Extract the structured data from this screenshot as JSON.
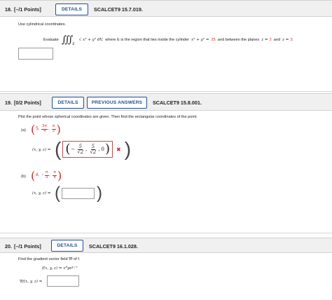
{
  "q18": {
    "number": "18.",
    "points": "[–/1 Points]",
    "details_label": "DETAILS",
    "code": "SCALCET9 15.7.019.",
    "instruction": "Use cylindrical coordinates.",
    "evaluate_word": "Evaluate",
    "region_subscript": "E",
    "integrand": "√ x² + y² dV,",
    "where_text": "where E is the region that lies inside the cylinder",
    "cyl_eq": "x² + y² =",
    "cyl_value": "25",
    "between_text": "and between the planes",
    "plane1": "z =",
    "plane1_value": "2",
    "and_text": "and",
    "plane2": "z =",
    "plane2_value": "3."
  },
  "q19": {
    "number": "19.",
    "points": "[0/2 Points]",
    "details_label": "DETAILS",
    "previous_label": "PREVIOUS ANSWERS",
    "code": "SCALCET9 15.8.001.",
    "instruction": "Plot the point whose spherical coordinates are given. Then find the rectangular coordinates of the point.",
    "part_a": {
      "label": "(a)",
      "first": "5,",
      "second_num": "3π",
      "second_den": "4",
      "third_num": "π",
      "third_den": "2",
      "xyz_label": "(x, y, z) =",
      "ans_x_num": "5",
      "ans_x_den": "√2",
      "ans_y_num": "5",
      "ans_y_den": "√2",
      "ans_z": "0",
      "result_mark": "✖"
    },
    "part_b": {
      "label": "(b)",
      "first": "8,",
      "second_num": "π",
      "second_den": "3",
      "third_num": "π",
      "third_den": "4",
      "xyz_label": "(x, y, z) ="
    }
  },
  "q20": {
    "number": "20.",
    "points": "[–/1 Points]",
    "details_label": "DETAILS",
    "code": "SCALCET9 16.1.028.",
    "instruction": "Find the gradient vector field ∇f of f.",
    "function_def": "f(x, y, z) = x",
    "exp1": "8",
    "mid": "ye",
    "exp2": "y / z",
    "gradient_label": "∇f(x, y, z) ="
  },
  "colors": {
    "header_bg": "#f0f0f0",
    "button_border": "#1f4f9a",
    "accent_red": "#d32a2a"
  }
}
